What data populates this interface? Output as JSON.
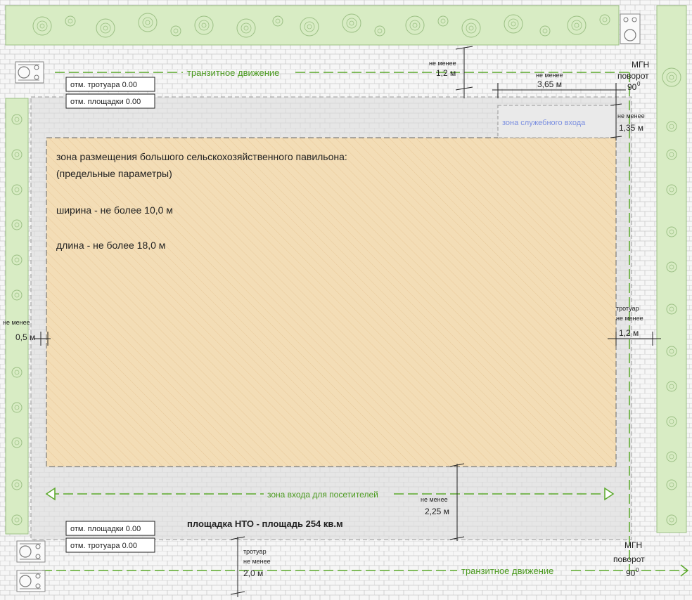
{
  "colors": {
    "greenery": "#d8ecc4",
    "paving": "#f4f4f4",
    "platform": "#e4e4e4",
    "pavilion_fill": "#f3ddb6",
    "transit_line": "#5aa82a",
    "service_text": "#7b8fe0"
  },
  "icons": {
    "wheelchair": "wheelchair-icon",
    "tree": "tree-icon"
  },
  "labels": {
    "transit_top": "транзитное движение",
    "transit_bottom": "транзитное движение",
    "visitor_entry": "зона входа для посетителей",
    "service_entry": "зона служебного входа",
    "elev_sidewalk_top": "отм. тротуара 0.00",
    "elev_platform_top": "отм. площадки 0.00",
    "elev_platform_bottom": "отм. площадки 0.00",
    "elev_sidewalk_bottom": "отм. тротуара 0.00",
    "area_title": "площадка НТО - площадь 254 кв.м"
  },
  "pavilion": {
    "line1": "зона размещения большого сельскохозяйственного павильона:",
    "line2": "(предельные параметры)",
    "width": "ширина - не более 10,0 м",
    "length": "длина - не более 18,0 м"
  },
  "dimensions": {
    "top_min_label": "не менее",
    "top_min_value": "1,2 м",
    "top_wide_label": "не менее",
    "top_wide_value": "3,65 м",
    "mgn_top_1": "МГН",
    "mgn_top_2": "поворот",
    "mgn_top_3": "90",
    "mgn_top_deg": "0",
    "service_min_label": "не менее",
    "service_min_value": "1,35 м",
    "right_sidewalk": "тротуар",
    "right_min_label": "не менее",
    "right_min_value": "1,2 м",
    "left_min_label": "не менее",
    "left_min_value": "0,5 м",
    "bottom_min_label": "не менее",
    "bottom_min_value": "2,25 м",
    "bottom_sidewalk": "тротуар",
    "bottom_sidewalk_min": "не менее",
    "bottom_sidewalk_value": "2,0 м",
    "mgn_bottom_1": "МГН",
    "mgn_bottom_2": "поворот",
    "mgn_bottom_3": "90",
    "mgn_bottom_deg": "0"
  }
}
